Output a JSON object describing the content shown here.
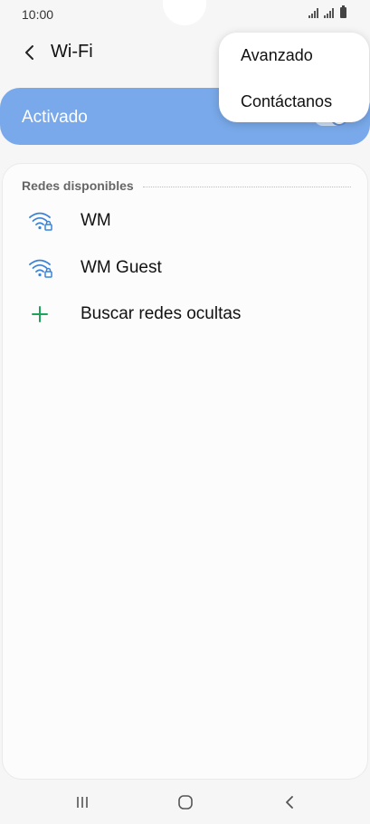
{
  "status_bar": {
    "time": "10:00"
  },
  "header": {
    "title": "Wi-Fi",
    "back_icon": "chevron-left-icon"
  },
  "master_switch": {
    "label": "Activado",
    "state": "on"
  },
  "networks": {
    "section_title": "Redes disponibles",
    "items": [
      {
        "label": "WM",
        "icon": "wifi-locked-icon"
      },
      {
        "label": "WM Guest",
        "icon": "wifi-locked-icon"
      }
    ],
    "add_hidden": {
      "label": "Buscar redes ocultas",
      "icon": "plus-icon"
    }
  },
  "popup_menu": {
    "items": [
      {
        "label": "Avanzado"
      },
      {
        "label": "Contáctanos"
      }
    ]
  },
  "nav_bar": {
    "items": [
      "recent-apps-icon",
      "home-icon",
      "back-icon"
    ]
  },
  "colors": {
    "accent": "#79a9ea",
    "wifi_icon": "#3b83d8",
    "plus_icon": "#1ea35a",
    "background": "#f6f6f6"
  }
}
